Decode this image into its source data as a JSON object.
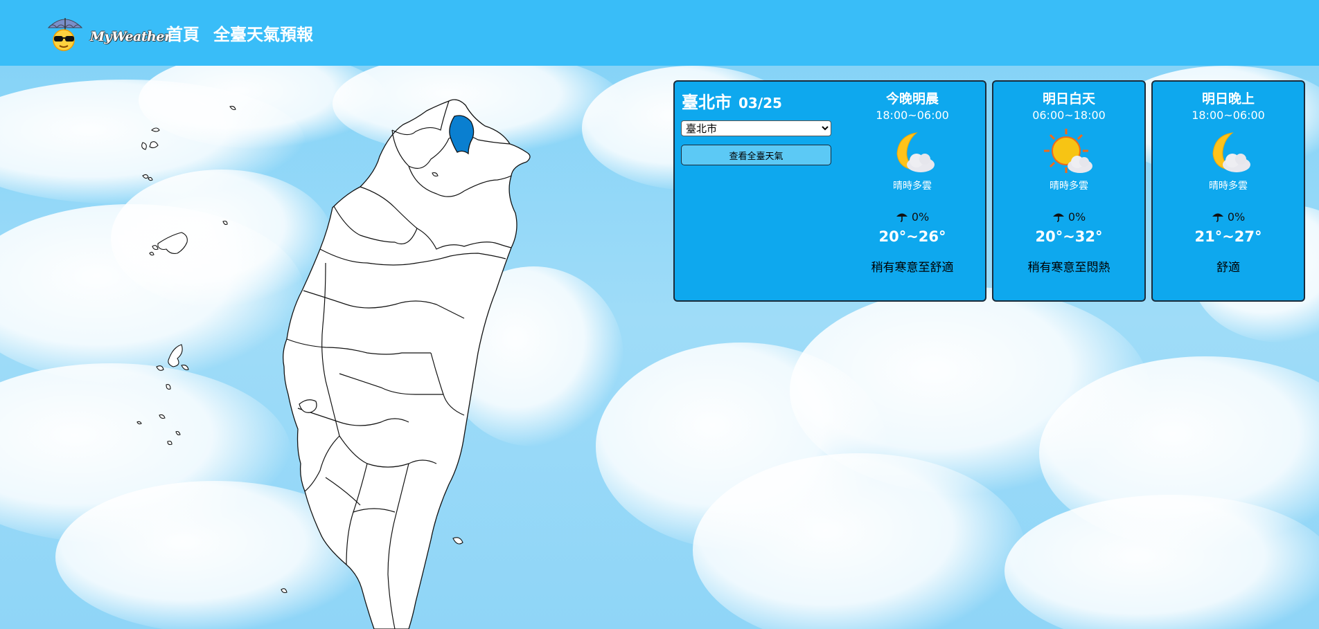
{
  "header": {
    "logo_text": "MyWeather",
    "nav": [
      {
        "label": "首頁"
      },
      {
        "label": "全臺天氣預報"
      }
    ],
    "bg_color": "#39bdf8"
  },
  "map": {
    "highlighted_county": "臺北市",
    "highlight_color": "#0a7fd0"
  },
  "panel": {
    "city": "臺北市",
    "date": "03/25",
    "select": {
      "selected": "臺北市"
    },
    "view_all_label": "查看全臺天氣",
    "forecasts": [
      {
        "title": "今晚明晨",
        "time": "18:00~06:00",
        "icon": "moon-cloud-icon",
        "desc": "晴時多雲",
        "rain": "0%",
        "temp": "20°~26°",
        "comfort": "稍有寒意至舒適"
      },
      {
        "title": "明日白天",
        "time": "06:00~18:00",
        "icon": "sun-cloud-icon",
        "desc": "晴時多雲",
        "rain": "0%",
        "temp": "20°~32°",
        "comfort": "稍有寒意至悶熱"
      },
      {
        "title": "明日晚上",
        "time": "18:00~06:00",
        "icon": "moon-cloud-icon",
        "desc": "晴時多雲",
        "rain": "0%",
        "temp": "21°~27°",
        "comfort": "舒適"
      }
    ],
    "bg_color": "#0ea8ee"
  }
}
